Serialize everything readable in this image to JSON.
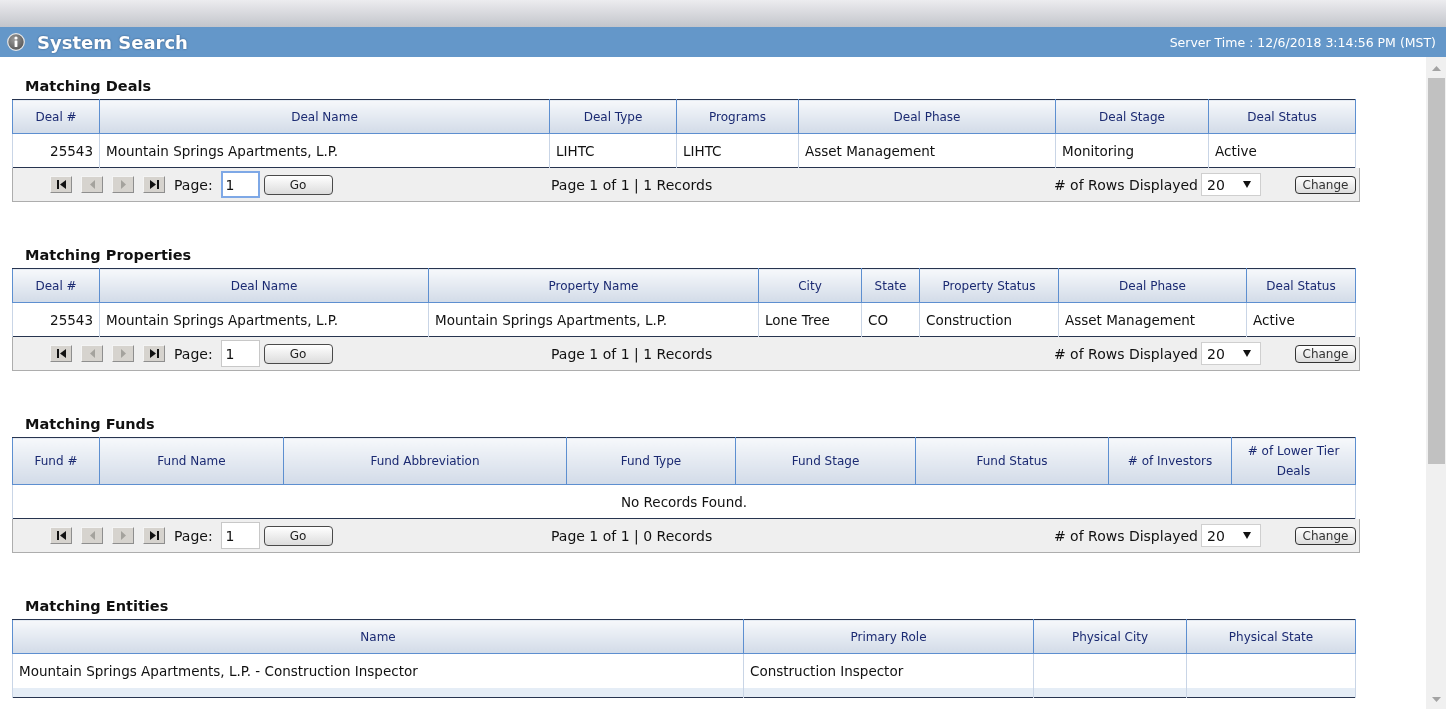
{
  "header": {
    "title": "System Search",
    "server_time": "Server Time : 12/6/2018 3:14:56 PM (MST)"
  },
  "sections": [
    {
      "title": "Matching Deals",
      "columns": [
        "Deal #",
        "Deal Name",
        "Deal Type",
        "Programs",
        "Deal Phase",
        "Deal Stage",
        "Deal Status"
      ],
      "rows": [
        [
          "25543",
          "Mountain Springs Apartments, L.P.",
          "LIHTC",
          "LIHTC",
          "Asset Management",
          "Monitoring",
          "Active"
        ]
      ],
      "pager": {
        "nav": [
          {
            "kind": "first",
            "disabled": false
          },
          {
            "kind": "previous",
            "disabled": true
          },
          {
            "kind": "next",
            "disabled": true
          },
          {
            "kind": "last",
            "disabled": false
          }
        ],
        "page_label": "Page:",
        "page_input": {
          "value": "1",
          "focused": true
        },
        "go_button": "Go",
        "summary": "Page 1 of 1 | 1 Records",
        "rows_label": "# of Rows Displayed",
        "rows_select": "20",
        "change_button": "Change"
      }
    },
    {
      "title": "Matching Properties",
      "columns": [
        "Deal #",
        "Deal Name",
        "Property Name",
        "City",
        "State",
        "Property Status",
        "Deal Phase",
        "Deal Status"
      ],
      "rows": [
        [
          "25543",
          "Mountain Springs Apartments, L.P.",
          "Mountain Springs Apartments, L.P.",
          "Lone Tree",
          "CO",
          "Construction",
          "Asset Management",
          "Active"
        ]
      ],
      "pager": {
        "nav": [
          {
            "kind": "first",
            "disabled": false
          },
          {
            "kind": "previous",
            "disabled": true
          },
          {
            "kind": "next",
            "disabled": true
          },
          {
            "kind": "last",
            "disabled": false
          }
        ],
        "page_label": "Page:",
        "page_input": {
          "value": "1",
          "focused": false
        },
        "go_button": "Go",
        "summary": "Page 1 of 1 | 1 Records",
        "rows_label": "# of Rows Displayed",
        "rows_select": "20",
        "change_button": "Change"
      }
    },
    {
      "title": "Matching Funds",
      "columns": [
        "Fund #",
        "Fund Name",
        "Fund Abbreviation",
        "Fund Type",
        "Fund Stage",
        "Fund Status",
        "# of Investors",
        "# of Lower Tier Deals"
      ],
      "empty_message": "No Records Found.",
      "pager": {
        "nav": [
          {
            "kind": "first",
            "disabled": false
          },
          {
            "kind": "previous",
            "disabled": true
          },
          {
            "kind": "next",
            "disabled": true
          },
          {
            "kind": "last",
            "disabled": false
          }
        ],
        "page_label": "Page:",
        "page_input": {
          "value": "1",
          "focused": false
        },
        "go_button": "Go",
        "summary": "Page 1 of 1 | 0 Records",
        "rows_label": "# of Rows Displayed",
        "rows_select": "20",
        "change_button": "Change"
      }
    },
    {
      "title": "Matching Entities",
      "columns": [
        "Name",
        "Primary Role",
        "Physical City",
        "Physical State"
      ],
      "rows": [
        [
          "Mountain Springs Apartments, L.P. - Construction Inspector",
          "Construction Inspector"
        ]
      ],
      "partial_row": true
    }
  ]
}
